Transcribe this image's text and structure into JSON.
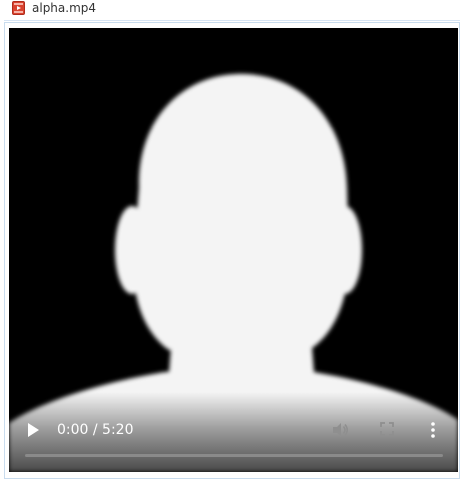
{
  "file": {
    "name": "alpha.mp4",
    "icon": "video-file-icon"
  },
  "player": {
    "current_time": "0:00",
    "duration": "5:20",
    "time_display": "0:00 / 5:20",
    "progress": 0.0,
    "icons": {
      "play": "play-icon",
      "volume": "volume-icon",
      "fullscreen": "fullscreen-icon",
      "more": "more-options-icon"
    }
  },
  "colors": {
    "background": "#000000",
    "silhouette": "#ffffff",
    "controls_text": "#ffffff",
    "progress_track": "#8a8a8a"
  }
}
